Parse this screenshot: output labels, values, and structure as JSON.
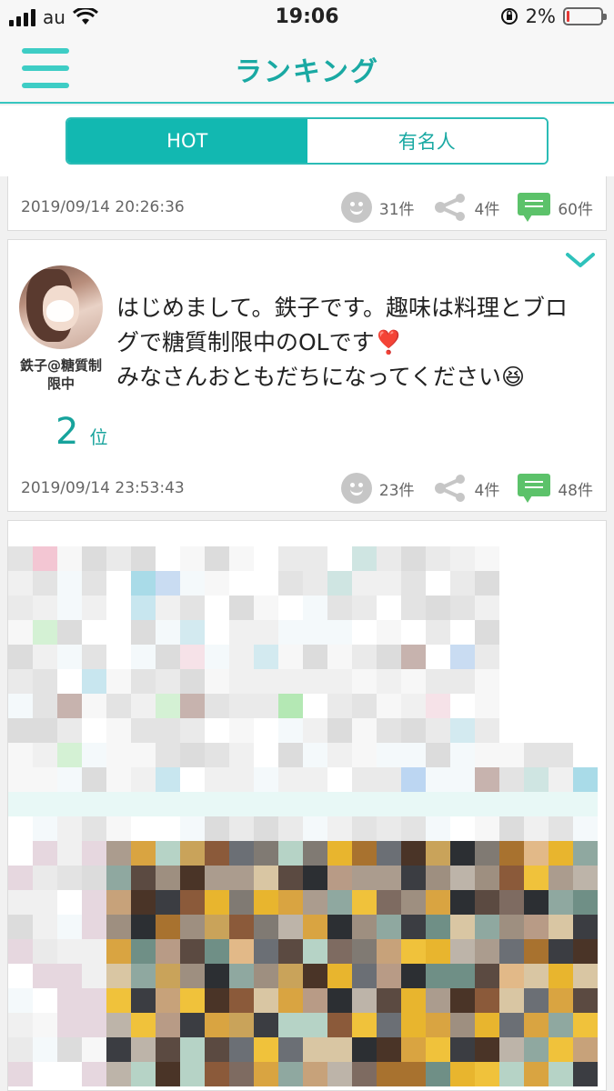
{
  "status_bar": {
    "carrier": "au",
    "time": "19:06",
    "battery_percent": "2%"
  },
  "nav": {
    "title": "ランキング"
  },
  "tabs": [
    {
      "label": "HOT",
      "active": true
    },
    {
      "label": "有名人",
      "active": false
    }
  ],
  "posts": [
    {
      "timestamp": "2019/09/14 20:26:36",
      "likes": "31件",
      "shares": "4件",
      "comments": "60件"
    },
    {
      "username": "鉄子@糖質制限中",
      "text_line1": "はじめまして。鉄子です。趣味は料理とブログで糖質制限中のOLです❣️",
      "text_line2": "みなさんおともだちになってください😆",
      "rank_number": "2",
      "rank_suffix": "位",
      "timestamp": "2019/09/14 23:53:43",
      "likes": "23件",
      "shares": "4件",
      "comments": "48件"
    }
  ],
  "colors": {
    "accent": "#12b8b1",
    "comment_green": "#5cc26a",
    "battery_low": "#e53935"
  },
  "icons": [
    "menu-icon",
    "smiley-icon",
    "share-icon",
    "comment-icon",
    "chevron-down-icon",
    "wifi-icon",
    "lock-rotation-icon"
  ]
}
